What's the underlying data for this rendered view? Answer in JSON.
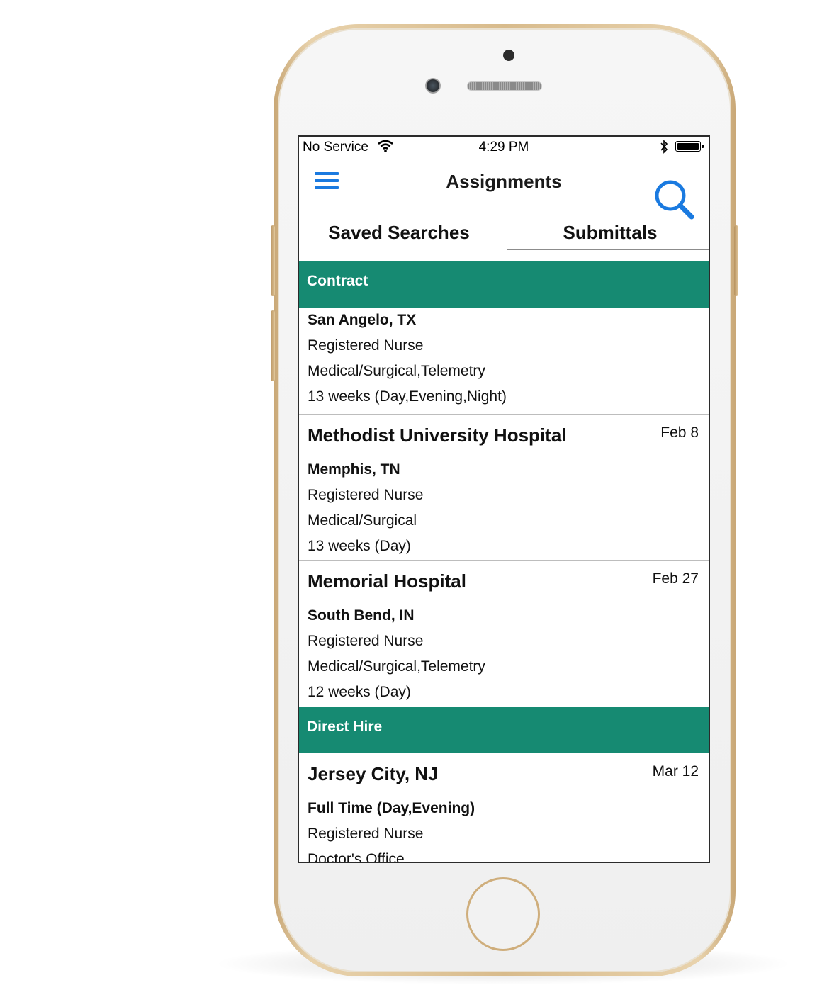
{
  "status_bar": {
    "carrier": "No Service",
    "time": "4:29 PM"
  },
  "nav": {
    "title": "Assignments"
  },
  "tabs": [
    "Saved Searches",
    "Submittals"
  ],
  "sections": [
    {
      "header": "Contract",
      "items": [
        {
          "title": "",
          "date": "",
          "subtitle": "San Angelo, TX",
          "lines": [
            "Registered Nurse",
            "Medical/Surgical,Telemetry",
            "13 weeks (Day,Evening,Night)"
          ]
        },
        {
          "title": "Methodist University Hospital",
          "date": "Feb 8",
          "subtitle": "Memphis, TN",
          "lines": [
            "Registered Nurse",
            "Medical/Surgical",
            "13 weeks (Day)"
          ]
        },
        {
          "title": "Memorial Hospital",
          "date": "Feb 27",
          "subtitle": "South Bend, IN",
          "lines": [
            "Registered Nurse",
            "Medical/Surgical,Telemetry",
            "12 weeks (Day)"
          ]
        }
      ]
    },
    {
      "header": "Direct Hire",
      "items": [
        {
          "title": "Jersey City, NJ",
          "date": "Mar 12",
          "subtitle": "Full Time (Day,Evening)",
          "lines": [
            "Registered Nurse",
            "Doctor's Office"
          ]
        }
      ]
    }
  ],
  "colors": {
    "accent_blue": "#1a7ae0",
    "section_green": "#168a72",
    "phone_gold": "#d8bb8c"
  }
}
